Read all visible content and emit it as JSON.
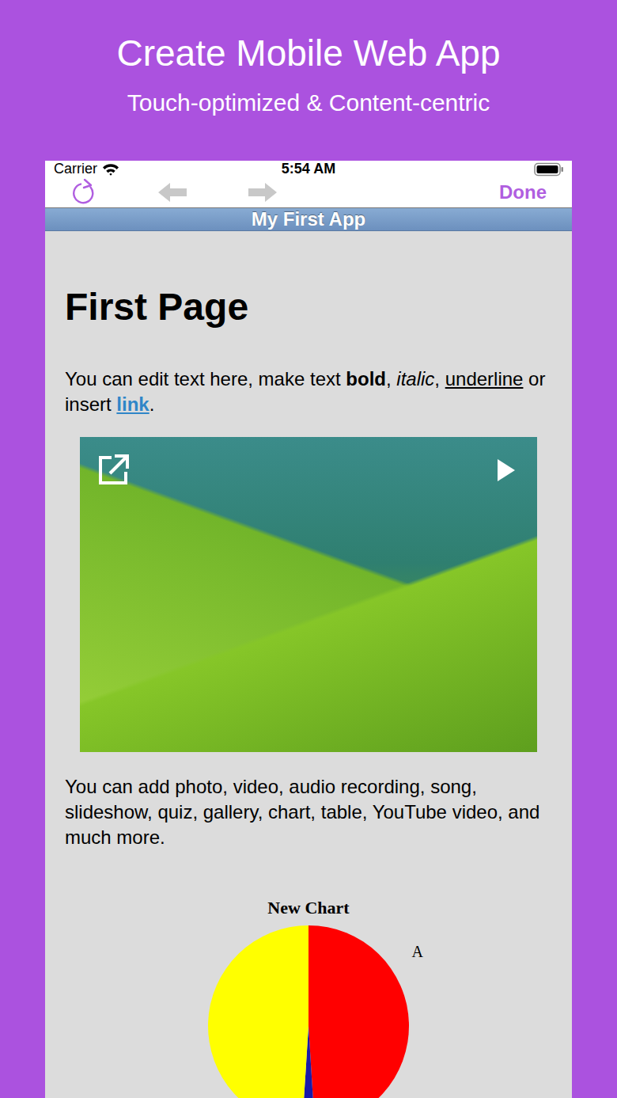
{
  "banner": {
    "title": "Create Mobile Web App",
    "subtitle": "Touch-optimized & Content-centric"
  },
  "status_bar": {
    "carrier": "Carrier",
    "time": "5:54 AM"
  },
  "toolbar": {
    "buttons": [
      {
        "name": "reload",
        "disabled": false
      },
      {
        "name": "back",
        "disabled": true
      },
      {
        "name": "forward",
        "disabled": true
      }
    ],
    "done": "Done"
  },
  "nav_bar": {
    "title": "My First App"
  },
  "page": {
    "heading": "First Page",
    "intro": [
      {
        "text": "You can edit text here, make text ",
        "style": "plain"
      },
      {
        "text": "bold",
        "style": "bold"
      },
      {
        "text": ", ",
        "style": "plain"
      },
      {
        "text": "italic",
        "style": "italic"
      },
      {
        "text": ", ",
        "style": "plain"
      },
      {
        "text": "underline",
        "style": "underline"
      },
      {
        "text": " or insert ",
        "style": "plain"
      },
      {
        "text": "link",
        "style": "link"
      },
      {
        "text": ".",
        "style": "plain"
      }
    ],
    "body": "You can add photo, video, audio recording, song, slideshow, quiz, gallery, chart, table, YouTube video, and much more.",
    "chart": {
      "title": "New Chart",
      "slices": [
        {
          "label": "A",
          "value": 49,
          "color": "#ff0000"
        },
        {
          "value": 2,
          "color": "#1a1aa8"
        },
        {
          "value": 49,
          "color": "#ffff00"
        }
      ]
    }
  }
}
